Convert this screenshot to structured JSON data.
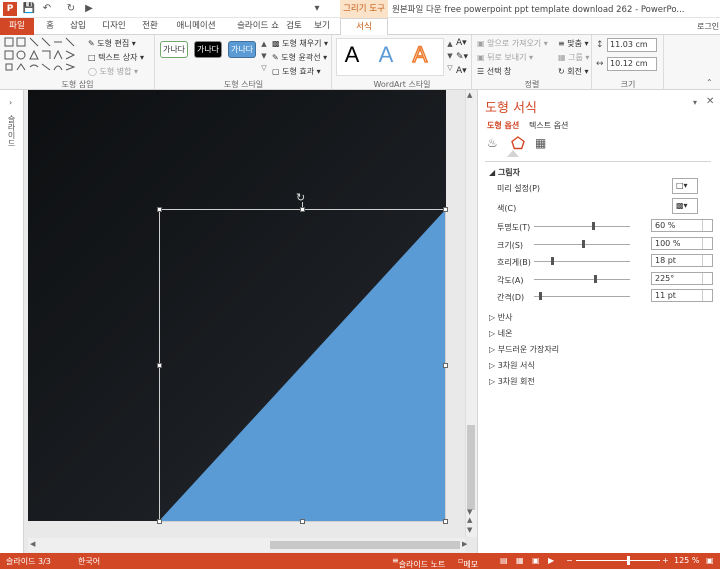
{
  "titlebar": {
    "context_tool": "그리기 도구",
    "title": "원본파일 다운 free powerpoint ppt template download 262 - PowerPo...",
    "login": "로그인"
  },
  "tabs": [
    "파일",
    "홈",
    "삽입",
    "디자인",
    "전환",
    "애니메이션",
    "슬라이드 쇼",
    "검토",
    "보기",
    "서식"
  ],
  "ribbon": {
    "insert_shapes": {
      "edit_shape": "도형 편집",
      "text_box": "텍스트 상자",
      "merge_shapes": "도형 병합",
      "label": "도형 삽입"
    },
    "shape_styles": {
      "sample": "가나다",
      "fill": "도형 채우기",
      "outline": "도형 윤곽선",
      "effects": "도형 효과",
      "label": "도형 스타일"
    },
    "wordart": {
      "letter": "A",
      "label": "WordArt 스타일"
    },
    "arrange": {
      "bring_forward": "앞으로 가져오기",
      "send_backward": "뒤로 보내기",
      "selection_pane": "선택 창",
      "align": "맞춤",
      "group": "그룹",
      "rotate": "회전",
      "label": "정렬"
    },
    "size": {
      "height": "11.03 cm",
      "width": "10.12 cm",
      "label": "크기"
    }
  },
  "pane": {
    "title": "도형 서식",
    "tab_shape_options": "도형 옵션",
    "tab_text_options": "텍스트 옵션",
    "section_shadow": "그림자",
    "preset_label": "미리 설정(P)",
    "color_label": "색(C)",
    "props": [
      {
        "label": "투명도(T)",
        "value": "60 %",
        "level": 0.6
      },
      {
        "label": "크기(S)",
        "value": "100 %",
        "level": 0.5
      },
      {
        "label": "흐리게(B)",
        "value": "18 pt",
        "level": 0.18
      },
      {
        "label": "각도(A)",
        "value": "225°",
        "level": 0.625
      },
      {
        "label": "간격(D)",
        "value": "11 pt",
        "level": 0.05
      }
    ],
    "sections": [
      "반사",
      "네온",
      "부드러운 가장자리",
      "3차원 서식",
      "3차원 회전"
    ]
  },
  "leftpane": {
    "label": "슬라이드"
  },
  "status": {
    "slide": "슬라이드 3/3",
    "language": "한국어",
    "notes": "슬라이드 노트",
    "comments": "메모",
    "zoom": "125 %"
  },
  "colors": {
    "accent": "#d24726",
    "shape_fill": "#5b9bd5",
    "slide_bg": "#16191c"
  }
}
